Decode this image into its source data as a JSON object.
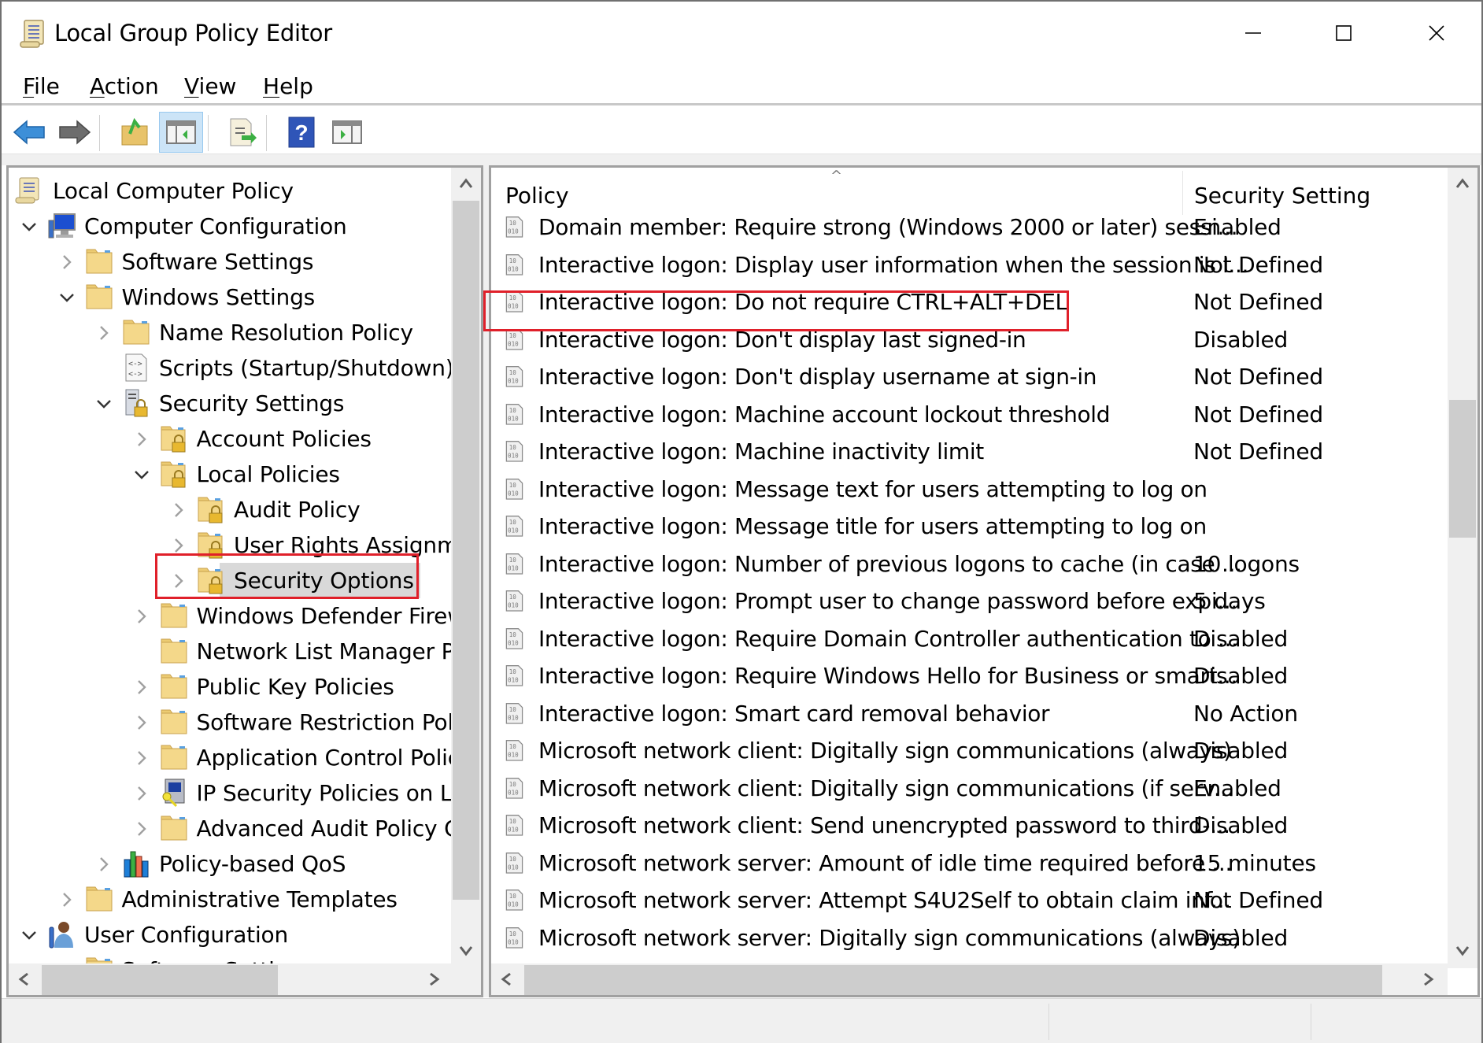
{
  "window": {
    "title": "Local Group Policy Editor",
    "controls": {
      "minimize": "minimize",
      "maximize": "maximize",
      "close": "close"
    }
  },
  "menu": [
    {
      "label": "File",
      "accel": "F",
      "rest": "ile"
    },
    {
      "label": "Action",
      "accel": "A",
      "rest": "ction"
    },
    {
      "label": "View",
      "accel": "V",
      "rest": "iew"
    },
    {
      "label": "Help",
      "accel": "H",
      "rest": "elp"
    }
  ],
  "toolbar": {
    "buttons": [
      {
        "name": "back",
        "icon": "back-arrow-icon"
      },
      {
        "name": "forward",
        "icon": "forward-arrow-icon"
      },
      {
        "name": "up-one-level",
        "icon": "folder-up-icon"
      },
      {
        "name": "show-hide-console-tree",
        "icon": "console-tree-icon",
        "active": true
      },
      {
        "name": "export-list",
        "icon": "export-list-icon"
      },
      {
        "name": "help",
        "icon": "help-icon"
      },
      {
        "name": "show-hide-action-pane",
        "icon": "action-pane-icon"
      }
    ]
  },
  "tree": {
    "items": [
      {
        "label": "Local Computer Policy",
        "level": 0,
        "icon": "policy-scroll-icon",
        "expander": "none"
      },
      {
        "label": "Computer Configuration",
        "level": 1,
        "icon": "computer-icon",
        "expander": "expanded"
      },
      {
        "label": "Software Settings",
        "level": 2,
        "icon": "folder-icon",
        "expander": "collapsed"
      },
      {
        "label": "Windows Settings",
        "level": 2,
        "icon": "folder-icon",
        "expander": "expanded"
      },
      {
        "label": "Name Resolution Policy",
        "level": 3,
        "icon": "folder-icon",
        "expander": "collapsed"
      },
      {
        "label": "Scripts (Startup/Shutdown)",
        "level": 3,
        "icon": "script-icon",
        "expander": "none"
      },
      {
        "label": "Security Settings",
        "level": 3,
        "icon": "security-settings-icon",
        "expander": "expanded"
      },
      {
        "label": "Account Policies",
        "level": 4,
        "icon": "locked-folder-icon",
        "expander": "collapsed"
      },
      {
        "label": "Local Policies",
        "level": 4,
        "icon": "locked-folder-icon",
        "expander": "expanded"
      },
      {
        "label": "Audit Policy",
        "level": 5,
        "icon": "locked-folder-icon",
        "expander": "collapsed"
      },
      {
        "label": "User Rights Assignment",
        "level": 5,
        "icon": "locked-folder-icon",
        "expander": "collapsed"
      },
      {
        "label": "Security Options",
        "level": 5,
        "icon": "locked-folder-icon",
        "expander": "collapsed",
        "selected": true
      },
      {
        "label": "Windows Defender Firewall with Advanced Security",
        "level": 4,
        "icon": "folder-icon",
        "expander": "collapsed"
      },
      {
        "label": "Network List Manager Policies",
        "level": 4,
        "icon": "folder-icon",
        "expander": "none"
      },
      {
        "label": "Public Key Policies",
        "level": 4,
        "icon": "folder-icon",
        "expander": "collapsed"
      },
      {
        "label": "Software Restriction Policies",
        "level": 4,
        "icon": "folder-icon",
        "expander": "collapsed"
      },
      {
        "label": "Application Control Policies",
        "level": 4,
        "icon": "folder-icon",
        "expander": "collapsed"
      },
      {
        "label": "IP Security Policies on Local Computer",
        "level": 4,
        "icon": "ip-security-icon",
        "expander": "collapsed"
      },
      {
        "label": "Advanced Audit Policy Configuration",
        "level": 4,
        "icon": "folder-icon",
        "expander": "collapsed"
      },
      {
        "label": "Policy-based QoS",
        "level": 3,
        "icon": "qos-chart-icon",
        "expander": "collapsed"
      },
      {
        "label": "Administrative Templates",
        "level": 2,
        "icon": "folder-icon",
        "expander": "collapsed"
      },
      {
        "label": "User Configuration",
        "level": 1,
        "icon": "user-config-icon",
        "expander": "expanded"
      },
      {
        "label": "Software Settings",
        "level": 2,
        "icon": "folder-icon",
        "expander": "collapsed"
      }
    ]
  },
  "list": {
    "columns": {
      "policy": "Policy",
      "setting": "Security Setting"
    },
    "sort_indicator": "^",
    "rows": [
      {
        "policy": "Domain member: Require strong (Windows 2000 or later) sessi...",
        "setting": "Enabled"
      },
      {
        "policy": "Interactive logon: Display user information when the session is l...",
        "setting": "Not Defined"
      },
      {
        "policy": "Interactive logon: Do not require CTRL+ALT+DEL",
        "setting": "Not Defined",
        "highlighted": true
      },
      {
        "policy": "Interactive logon: Don't display last signed-in",
        "setting": "Disabled"
      },
      {
        "policy": "Interactive logon: Don't display username at sign-in",
        "setting": "Not Defined"
      },
      {
        "policy": "Interactive logon: Machine account lockout threshold",
        "setting": "Not Defined"
      },
      {
        "policy": "Interactive logon: Machine inactivity limit",
        "setting": "Not Defined"
      },
      {
        "policy": "Interactive logon: Message text for users attempting to log on",
        "setting": ""
      },
      {
        "policy": "Interactive logon: Message title for users attempting to log on",
        "setting": ""
      },
      {
        "policy": "Interactive logon: Number of previous logons to cache (in case ...",
        "setting": "10 logons"
      },
      {
        "policy": "Interactive logon: Prompt user to change password before expi...",
        "setting": "5 days"
      },
      {
        "policy": "Interactive logon: Require Domain Controller authentication to ...",
        "setting": "Disabled"
      },
      {
        "policy": "Interactive logon: Require Windows Hello for Business or smart...",
        "setting": "Disabled"
      },
      {
        "policy": "Interactive logon: Smart card removal behavior",
        "setting": "No Action"
      },
      {
        "policy": "Microsoft network client: Digitally sign communications (always)",
        "setting": "Disabled"
      },
      {
        "policy": "Microsoft network client: Digitally sign communications (if serv...",
        "setting": "Enabled"
      },
      {
        "policy": "Microsoft network client: Send unencrypted password to third-...",
        "setting": "Disabled"
      },
      {
        "policy": "Microsoft network server: Amount of idle time required before ...",
        "setting": "15 minutes"
      },
      {
        "policy": "Microsoft network server: Attempt S4U2Self to obtain claim inf...",
        "setting": "Not Defined"
      },
      {
        "policy": "Microsoft network server: Digitally sign communications (always)",
        "setting": "Disabled"
      }
    ]
  },
  "colors": {
    "highlight_box": "#e0202a",
    "selection": "#d9d9d9",
    "toolbar_active": "#cce4f7",
    "scroll_thumb": "#cdcdcd",
    "chrome": "#f0f0f0"
  }
}
